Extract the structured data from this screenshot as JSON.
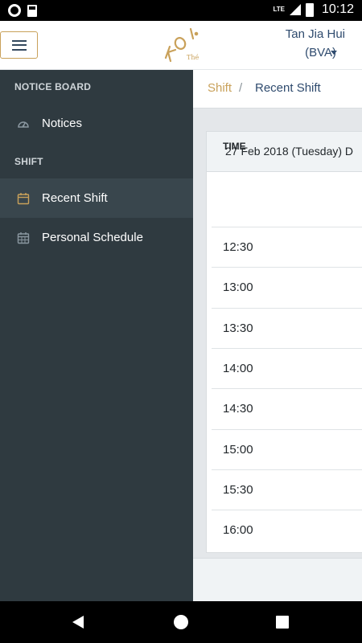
{
  "status_bar": {
    "network": "LTE",
    "time": "10:12"
  },
  "header": {
    "menu_icon": "hamburger-icon",
    "logo_text": "KOI",
    "logo_sub": "Thé",
    "user_name": "Tan Jia Hui",
    "user_branch": "(BVA)"
  },
  "sidebar": {
    "sections": [
      {
        "title": "NOTICE BOARD",
        "items": [
          {
            "label": "Notices",
            "icon": "speedometer-icon"
          }
        ]
      },
      {
        "title": "SHIFT",
        "items": [
          {
            "label": "Recent Shift",
            "icon": "calendar-icon",
            "active": true
          },
          {
            "label": "Personal Schedule",
            "icon": "calendar-grid-icon"
          }
        ]
      }
    ]
  },
  "breadcrumb": {
    "parent": "Shift",
    "separator": "/",
    "current": "Recent Shift"
  },
  "card": {
    "title": "27 Feb 2018 (Tuesday) D",
    "column_header": "TIME",
    "times": [
      "12:30",
      "13:00",
      "13:30",
      "14:00",
      "14:30",
      "15:00",
      "15:30",
      "16:00"
    ]
  },
  "colors": {
    "accent": "#c9a15a",
    "sidebar_bg": "#2f3a40",
    "sidebar_active": "#39464d",
    "text_primary": "#2f4b6e"
  }
}
